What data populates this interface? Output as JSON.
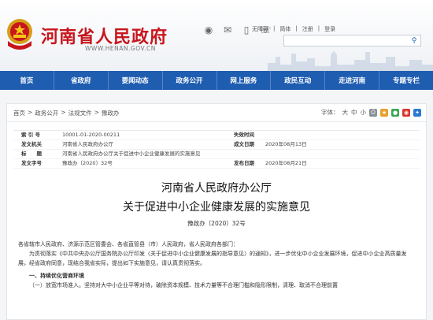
{
  "header": {
    "site_title": "河南省人民政府",
    "site_url": "WWW.HENAN.GOV.CN",
    "top_links": [
      "无障碍",
      "|",
      "简体",
      "|",
      "注册",
      "|",
      "登录"
    ],
    "search_placeholder": ""
  },
  "nav": {
    "items": [
      "首页",
      "省政府",
      "要闻动态",
      "政务公开",
      "网上服务",
      "政民互动",
      "走进河南",
      "专题专栏"
    ]
  },
  "breadcrumb": [
    "首页",
    ">",
    "政务公开",
    ">",
    "法规文件",
    ">",
    "豫政办"
  ],
  "tools": {
    "font_label": "字体：",
    "sizes": [
      "大",
      "中",
      "小"
    ]
  },
  "meta": [
    {
      "k": "索 引 号",
      "v": "10001-01-2020-00211",
      "k2": "失效时间",
      "v2": ""
    },
    {
      "k": "发文机关",
      "v": "河南省人民政府办公厅",
      "k2": "成文日期",
      "v2": "2020年08月13日"
    },
    {
      "k": "标　　题",
      "v": "河南省人民政府办公厅关于促进中小企业健康发展的实施意见",
      "k2": "",
      "v2": ""
    },
    {
      "k": "发文字号",
      "v": "豫政办〔2020〕32号",
      "k2": "发布日期",
      "v2": "2020年08月21日"
    }
  ],
  "document": {
    "title_line1": "河南省人民政府办公厅",
    "title_line2": "关于促进中小企业健康发展的实施意见",
    "doc_number": "豫政办〔2020〕32号",
    "salutation": "各省辖市人民政府、济源示范区管委会、各省直管县（市）人民政府，省人民政府各部门：",
    "para1": "为贯彻落实《中共中央办公厅国务院办公厅印发〈关于促进中小企业健康发展的指导意见〉的通知》，进一步优化中小企业发展环境，促进中小企业高质量发展，经省政府同意，现结合我省实际，提出如下实施意见，请认真贯彻落实。",
    "section1": "一、持续优化营商环境",
    "para2": "（一）放宽市场准入。坚持对大中小企业平等对待，破除资本规模、技术力量等不合理门槛和隐形限制，清理、取消不合理前置"
  }
}
